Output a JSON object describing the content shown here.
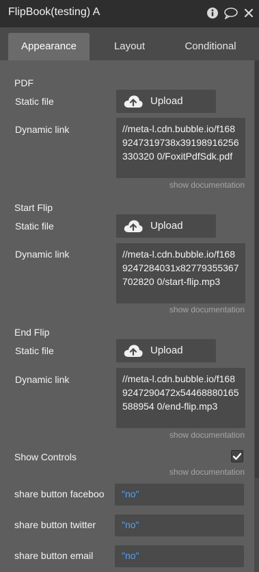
{
  "window": {
    "title": "FlipBook(testing) A",
    "icons": [
      "info-icon",
      "comment-icon",
      "close-icon"
    ]
  },
  "tabs": [
    {
      "label": "Appearance",
      "active": true
    },
    {
      "label": "Layout",
      "active": false
    },
    {
      "label": "Conditional",
      "active": false
    }
  ],
  "sections": [
    {
      "title": "PDF",
      "static_file_label": "Static file",
      "upload_label": "Upload",
      "dynamic_link_label": "Dynamic link",
      "dynamic_link_value": "//meta-l.cdn.bubble.io/f1689247319738x39198916256330320 0/FoxitPdfSdk.pdf",
      "docs_label": "show documentation"
    },
    {
      "title": "Start Flip",
      "static_file_label": "Static file",
      "upload_label": "Upload",
      "dynamic_link_label": "Dynamic link",
      "dynamic_link_value": "//meta-l.cdn.bubble.io/f1689247284031x82779355367702820 0/start-flip.mp3",
      "docs_label": "show documentation"
    },
    {
      "title": "End Flip",
      "static_file_label": "Static file",
      "upload_label": "Upload",
      "dynamic_link_label": "Dynamic link",
      "dynamic_link_value": "//meta-l.cdn.bubble.io/f1689247290472x54468880165588954 0/end-flip.mp3",
      "docs_label": "show documentation"
    }
  ],
  "show_controls": {
    "label": "Show Controls",
    "checked": true,
    "docs_label": "show documentation"
  },
  "share_fields": [
    {
      "label": "share button faceboo",
      "value": "\"no\""
    },
    {
      "label": "share button twitter",
      "value": "\"no\""
    },
    {
      "label": "share button email",
      "value": "\"no\""
    }
  ],
  "colors": {
    "titlebar": "#2e2e2e",
    "panel": "#5e5e5e",
    "field": "#4a4a4a",
    "dynamic_value": "#4ea3f5"
  }
}
